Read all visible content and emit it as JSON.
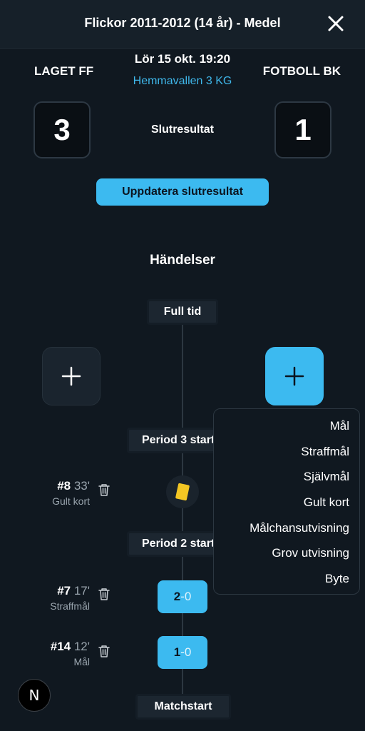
{
  "header": {
    "title": "Flickor 2011-2012 (14 år) - Medel"
  },
  "match": {
    "home_team": "LAGET FF",
    "away_team": "FOTBOLL BK",
    "date": "Lör 15 okt. 19:20",
    "venue": "Hemmavallen 3 KG",
    "home_score": "3",
    "away_score": "1",
    "score_label": "Slutresultat"
  },
  "update_button": "Uppdatera slutresultat",
  "events": {
    "heading": "Händelser",
    "markers": {
      "full_time": "Full tid",
      "period3": "Period 3 start",
      "period2": "Period 2 start",
      "match_start": "Matchstart"
    },
    "items": [
      {
        "number": "#8",
        "minute": "33'",
        "type": "Gult kort"
      },
      {
        "number": "#7",
        "minute": "17'",
        "type": "Straffmål",
        "score_home": "2",
        "score_sep": "-",
        "score_away": "0"
      },
      {
        "number": "#14",
        "minute": "12'",
        "type": "Mål",
        "score_home": "1",
        "score_sep": "-",
        "score_away": "0"
      }
    ]
  },
  "dropdown": {
    "items": [
      "Mål",
      "Straffmål",
      "Självmål",
      "Gult kort",
      "Målchansutvisning",
      "Grov utvisning",
      "Byte"
    ]
  },
  "badge": {
    "letter": "N"
  },
  "colors": {
    "accent": "#3cbaf0",
    "background": "#101820",
    "yellow_card": "#f3c623"
  },
  "icons": [
    "close-icon",
    "plus-icon",
    "trash-icon",
    "yellow-card-icon"
  ]
}
